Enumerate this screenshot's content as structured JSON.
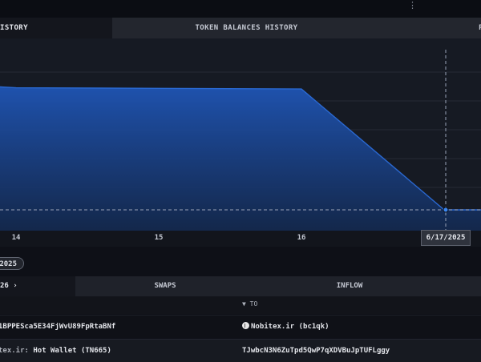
{
  "topbar": {
    "overflow": "⋮"
  },
  "tabs": [
    {
      "label": "ISTORY",
      "active": true
    },
    {
      "label": "TOKEN BALANCES HISTORY",
      "active": false
    },
    {
      "label": "P",
      "active": false
    }
  ],
  "chart_data": {
    "type": "area",
    "title": "",
    "xlabel": "",
    "ylabel": "",
    "x_ticks": [
      "14",
      "15",
      "16"
    ],
    "highlight_date": "6/17/2025",
    "series": [
      {
        "x": [
          "6/13/2025",
          "6/14/2025",
          "6/15/2025",
          "6/16/2025",
          "6/17/2025",
          "6/17/2025 12:00"
        ],
        "values": [
          100,
          99,
          98.5,
          98,
          0,
          0
        ]
      }
    ],
    "grid": true,
    "colors": {
      "fill": "#1d4fa8",
      "line": "#2a68d0",
      "crosshair": "#9aa4b8"
    }
  },
  "year_pill": "2025",
  "subtabs": [
    {
      "label": "26 ›",
      "active": true
    },
    {
      "label": "SWAPS",
      "active": false
    },
    {
      "label": "INFLOW",
      "active": false
    }
  ],
  "table": {
    "to_header": "▼ TO",
    "rows": [
      {
        "from": "1BPPESca5E34FjWvU89FpRtaBNf",
        "to": "Nobitex.ir (bc1qk)",
        "to_icon": "nobitex-logo-icon"
      },
      {
        "from_prefix": "tex.ir: ",
        "from": "Hot Wallet (TN665)",
        "to": "TJwbcN3N6ZuTpd5QwP7qXDVBuJpTUFLggy"
      }
    ]
  }
}
